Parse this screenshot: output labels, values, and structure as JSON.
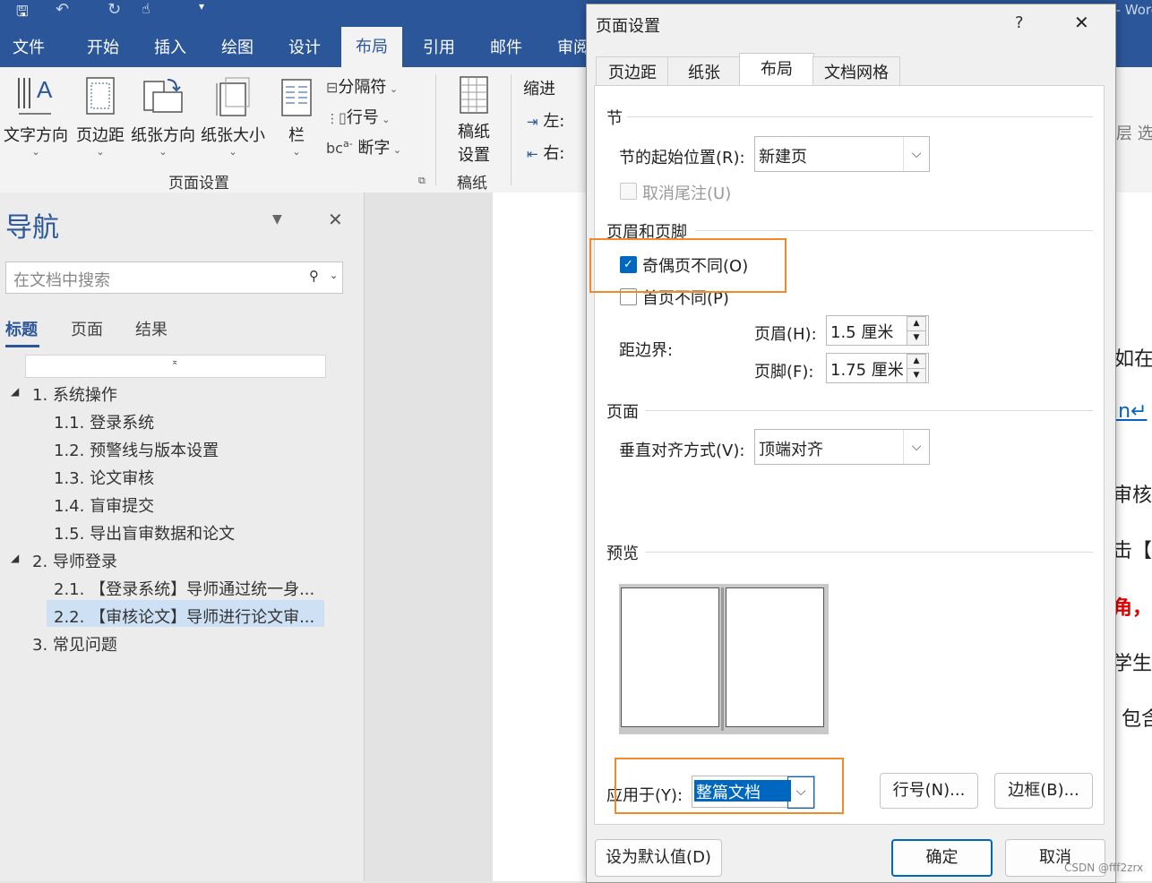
{
  "window": {
    "title_fragment": "…docx - Word"
  },
  "ribbon": {
    "tabs": [
      "文件",
      "开始",
      "插入",
      "绘图",
      "设计",
      "布局",
      "引用",
      "邮件",
      "审阅"
    ],
    "active_tab": "布局",
    "page_setup_group": {
      "label": "页面设置",
      "buttons": [
        "文字方向",
        "页边距",
        "纸张方向",
        "纸张大小",
        "栏"
      ],
      "small_buttons": [
        "分隔符",
        "行号",
        "断字"
      ]
    },
    "manuscript_group": {
      "label": "稿纸",
      "button_line1": "稿纸",
      "button_line2": "设置"
    },
    "indent_group": {
      "label": "缩进",
      "left": "左:",
      "right": "右:"
    },
    "right_fragment": "层 选"
  },
  "nav_pane": {
    "title": "导航",
    "search_placeholder": "在文档中搜索",
    "tabs": [
      "标题",
      "页面",
      "结果"
    ],
    "active_tab": "标题",
    "tree": [
      {
        "level": 1,
        "text": "1. 系统操作",
        "expanded": true
      },
      {
        "level": 2,
        "text": "1.1. 登录系统"
      },
      {
        "level": 2,
        "text": "1.2. 预警线与版本设置"
      },
      {
        "level": 2,
        "text": "1.3. 论文审核"
      },
      {
        "level": 2,
        "text": "1.4. 盲审提交"
      },
      {
        "level": 2,
        "text": "1.5. 导出盲审数据和论文"
      },
      {
        "level": 1,
        "text": "2. 导师登录",
        "expanded": true
      },
      {
        "level": 2,
        "text": "2.1. 【登录系统】导师通过统一身..."
      },
      {
        "level": 2,
        "text": "2.2. 【审核论文】导师进行论文审...",
        "selected": true
      },
      {
        "level": 1,
        "text": "3. 常见问题"
      }
    ]
  },
  "document_fragments": [
    "如在",
    "in↵",
    "审核",
    "击【",
    "角，",
    "学生",
    "包含"
  ],
  "dialog": {
    "title": "页面设置",
    "help": "?",
    "close": "✕",
    "tabs": [
      "页边距",
      "纸张",
      "布局",
      "文档网格"
    ],
    "active_tab": "布局",
    "section": {
      "title": "节",
      "start_label": "节的起始位置(R):",
      "start_value": "新建页",
      "suppress_endnotes": "取消尾注(U)",
      "suppress_endnotes_checked": false
    },
    "headers_footers": {
      "title": "页眉和页脚",
      "odd_even": "奇偶页不同(O)",
      "odd_even_checked": true,
      "first_page": "首页不同(P)",
      "first_page_checked": false,
      "from_edge_label": "距边界:",
      "header_label": "页眉(H):",
      "header_value": "1.5 厘米",
      "footer_label": "页脚(F):",
      "footer_value": "1.75 厘米"
    },
    "page": {
      "title": "页面",
      "valign_label": "垂直对齐方式(V):",
      "valign_value": "顶端对齐"
    },
    "preview": {
      "title": "预览"
    },
    "apply_to_label": "应用于(Y):",
    "apply_to_value": "整篇文档",
    "line_numbers_button": "行号(N)...",
    "borders_button": "边框(B)...",
    "set_default_button": "设为默认值(D)",
    "ok_button": "确定",
    "cancel_button": "取消"
  },
  "watermark": "CSDN @fff2zrx"
}
